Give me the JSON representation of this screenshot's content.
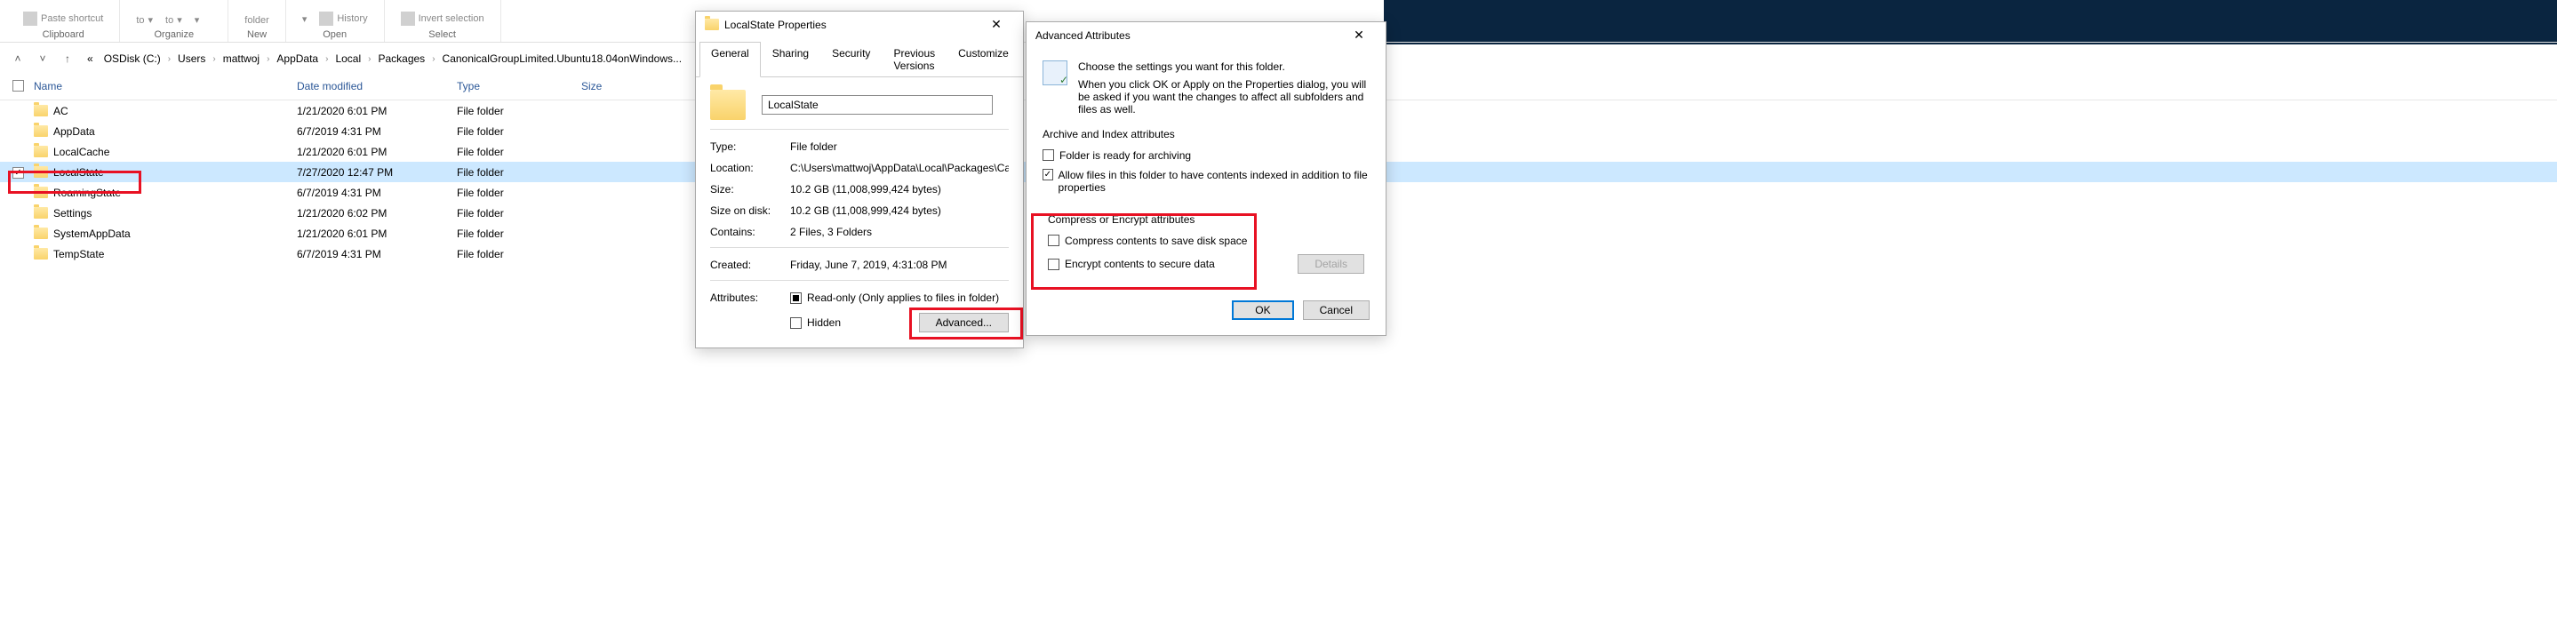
{
  "ribbon": {
    "paste_shortcut": "Paste shortcut",
    "clipboard": "Clipboard",
    "move_to": "to",
    "copy_to": "to",
    "delete": "",
    "rename": "",
    "organize": "Organize",
    "new_folder": "folder",
    "new": "New",
    "properties": "",
    "history": "History",
    "open": "Open",
    "invert": "Invert selection",
    "select": "Select"
  },
  "breadcrumb": {
    "items": [
      "OSDisk (C:)",
      "Users",
      "mattwoj",
      "AppData",
      "Local",
      "Packages",
      "CanonicalGroupLimited.Ubuntu18.04onWindows..."
    ]
  },
  "columns": {
    "name": "Name",
    "date": "Date modified",
    "type": "Type",
    "size": "Size"
  },
  "rows": [
    {
      "name": "AC",
      "date": "1/21/2020 6:01 PM",
      "type": "File folder",
      "checked": false,
      "selected": false
    },
    {
      "name": "AppData",
      "date": "6/7/2019 4:31 PM",
      "type": "File folder",
      "checked": false,
      "selected": false
    },
    {
      "name": "LocalCache",
      "date": "1/21/2020 6:01 PM",
      "type": "File folder",
      "checked": false,
      "selected": false
    },
    {
      "name": "LocalState",
      "date": "7/27/2020 12:47 PM",
      "type": "File folder",
      "checked": true,
      "selected": true
    },
    {
      "name": "RoamingState",
      "date": "6/7/2019 4:31 PM",
      "type": "File folder",
      "checked": false,
      "selected": false
    },
    {
      "name": "Settings",
      "date": "1/21/2020 6:02 PM",
      "type": "File folder",
      "checked": false,
      "selected": false
    },
    {
      "name": "SystemAppData",
      "date": "1/21/2020 6:01 PM",
      "type": "File folder",
      "checked": false,
      "selected": false
    },
    {
      "name": "TempState",
      "date": "6/7/2019 4:31 PM",
      "type": "File folder",
      "checked": false,
      "selected": false
    }
  ],
  "props": {
    "title": "LocalState Properties",
    "tabs": [
      "General",
      "Sharing",
      "Security",
      "Previous Versions",
      "Customize"
    ],
    "name_value": "LocalState",
    "type_label": "Type:",
    "type_value": "File folder",
    "location_label": "Location:",
    "location_value": "C:\\Users\\mattwoj\\AppData\\Local\\Packages\\Canonic",
    "size_label": "Size:",
    "size_value": "10.2 GB (11,008,999,424 bytes)",
    "sizeondisk_label": "Size on disk:",
    "sizeondisk_value": "10.2 GB (11,008,999,424 bytes)",
    "contains_label": "Contains:",
    "contains_value": "2 Files, 3 Folders",
    "created_label": "Created:",
    "created_value": "Friday, June 7, 2019, 4:31:08 PM",
    "attributes_label": "Attributes:",
    "readonly": "Read-only (Only applies to files in folder)",
    "hidden": "Hidden",
    "advanced_btn": "Advanced..."
  },
  "adv": {
    "title": "Advanced Attributes",
    "intro1": "Choose the settings you want for this folder.",
    "intro2": "When you click OK or Apply on the Properties dialog, you will be asked if you want the changes to affect all subfolders and files as well.",
    "archive_header": "Archive and Index attributes",
    "archive_ready": "Folder is ready for archiving",
    "allow_index": "Allow files in this folder to have contents indexed in addition to file properties",
    "compress_header": "Compress or Encrypt attributes",
    "compress": "Compress contents to save disk space",
    "encrypt": "Encrypt contents to secure data",
    "details": "Details",
    "ok": "OK",
    "cancel": "Cancel"
  }
}
